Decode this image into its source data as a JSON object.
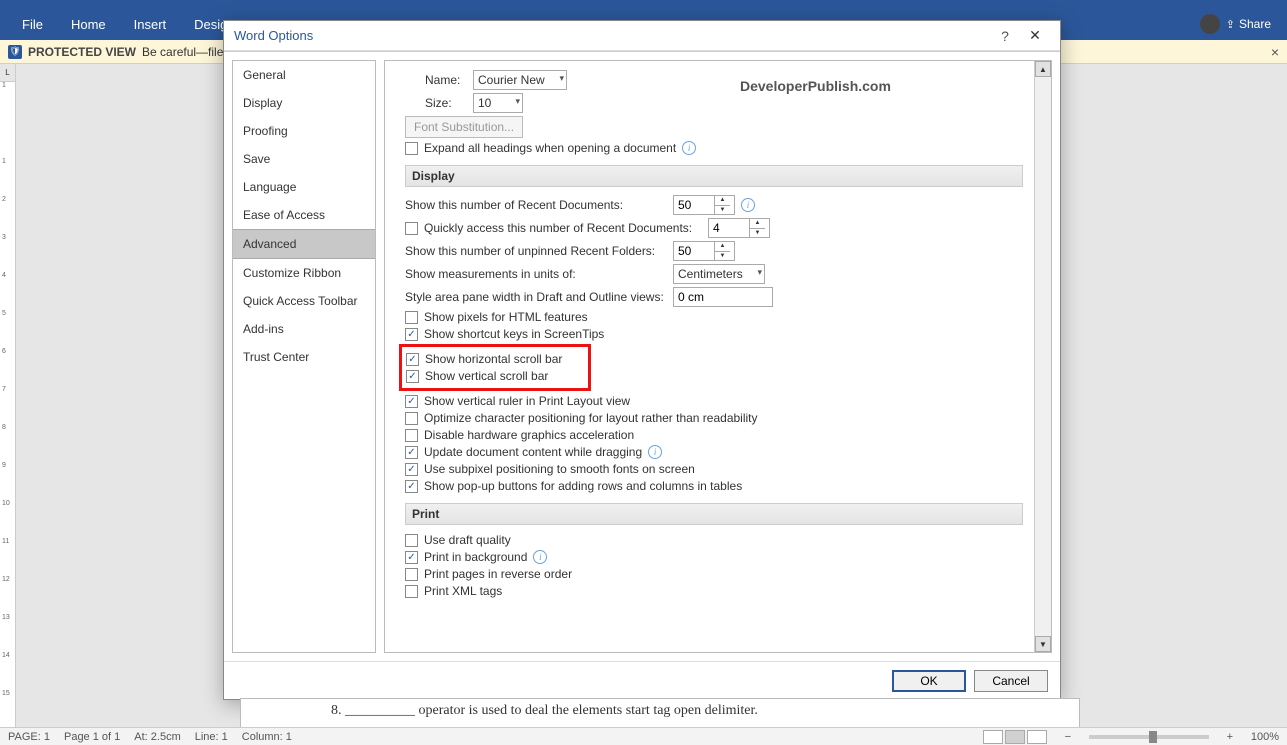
{
  "ribbon": {
    "tabs": [
      "File",
      "Home",
      "Insert",
      "Design"
    ],
    "share": "Share"
  },
  "protected": {
    "label": "PROTECTED VIEW",
    "text": "Be careful—file",
    "close": "×"
  },
  "dialog": {
    "title": "Word Options",
    "nav": [
      "General",
      "Display",
      "Proofing",
      "Save",
      "Language",
      "Ease of Access",
      "Advanced",
      "Customize Ribbon",
      "Quick Access Toolbar",
      "Add-ins",
      "Trust Center"
    ],
    "selected_nav": "Advanced",
    "font_name_label": "Name:",
    "font_name_value": "Courier New",
    "font_size_label": "Size:",
    "font_size_value": "10",
    "font_sub_btn": "Font Substitution...",
    "expand_headings": "Expand all headings when opening a document",
    "section_display": "Display",
    "recent_docs_label": "Show this number of Recent Documents:",
    "recent_docs_value": "50",
    "quick_access_label": "Quickly access this number of Recent Documents:",
    "quick_access_value": "4",
    "unpinned_label": "Show this number of unpinned Recent Folders:",
    "unpinned_value": "50",
    "units_label": "Show measurements in units of:",
    "units_value": "Centimeters",
    "style_area_label": "Style area pane width in Draft and Outline views:",
    "style_area_value": "0 cm",
    "chk_pixels": "Show pixels for HTML features",
    "chk_shortcut": "Show shortcut keys in ScreenTips",
    "chk_hscroll": "Show horizontal scroll bar",
    "chk_vscroll": "Show vertical scroll bar",
    "chk_vruler": "Show vertical ruler in Print Layout view",
    "chk_optimize": "Optimize character positioning for layout rather than readability",
    "chk_hw_accel": "Disable hardware graphics acceleration",
    "chk_dragging": "Update document content while dragging",
    "chk_subpixel": "Use subpixel positioning to smooth fonts on screen",
    "chk_popup": "Show pop-up buttons for adding rows and columns in tables",
    "section_print": "Print",
    "chk_draft": "Use draft quality",
    "chk_bg": "Print in background",
    "chk_reverse": "Print pages in reverse order",
    "chk_xml": "Print XML tags",
    "ok": "OK",
    "cancel": "Cancel"
  },
  "watermark": "DeveloperPublish.com",
  "doc_line": "8.    __________ operator is used to deal the elements start tag open delimiter.",
  "status": {
    "page_a": "PAGE: 1",
    "page_b": "Page 1 of 1",
    "at": "At: 2.5cm",
    "line": "Line: 1",
    "col": "Column: 1",
    "zoom": "100%"
  },
  "ruler_marks": [
    "1",
    "",
    "1",
    "2",
    "3",
    "4",
    "5",
    "6",
    "7",
    "8",
    "9",
    "10",
    "11",
    "12",
    "13",
    "14",
    "15"
  ]
}
